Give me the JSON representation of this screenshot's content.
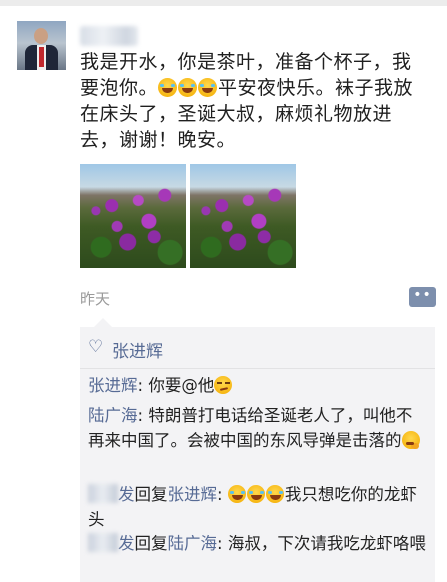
{
  "post": {
    "author_name": "",
    "text_part1": "我是开水，你是茶叶，准备个杯子，我要泡你。",
    "text_part2": "平安夜快乐。袜子我放在床头了，圣诞大叔，麻烦礼物放进去，谢谢！晚安。",
    "emojis": [
      "laugh-cry-emoji",
      "laugh-cry-emoji",
      "laugh-cry-emoji"
    ],
    "photos": [
      "bougainvillea-photo",
      "bougainvillea-photo"
    ],
    "time": "昨天",
    "more_button": "••"
  },
  "likes": {
    "icon": "heart-outline-icon",
    "names": "张进辉"
  },
  "comments": [
    {
      "author": "张进辉",
      "separator": ": ",
      "text": "你要@他",
      "emoji": "smirk-emoji"
    },
    {
      "author": "陆广海",
      "separator": ": ",
      "text": "特朗普打电话给圣诞老人了，叫他不再来中国了。会被中国的东风导弹是击落的",
      "emoji": "thinking-emoji"
    },
    {
      "author_visible": "发",
      "reply_word": "回复",
      "reply_to": "张进辉",
      "separator": ": ",
      "text": "我只想吃你的龙虾头",
      "emoji": "laugh-cry-emoji"
    },
    {
      "author_visible": "发",
      "reply_word": "回复",
      "reply_to": "陆广海",
      "separator": ": ",
      "text": "海叔，下次请我吃龙虾咯喂"
    }
  ],
  "colors": {
    "link_blue": "#576b95",
    "comment_bg": "#f3f3f5",
    "time_gray": "#9a9a9a"
  }
}
